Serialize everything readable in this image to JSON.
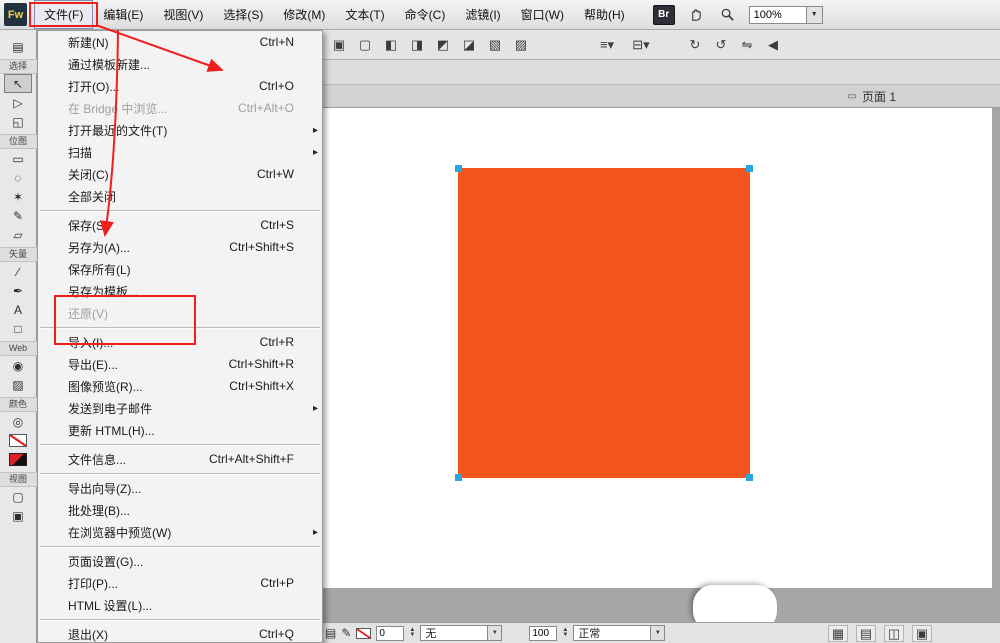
{
  "colors": {
    "annotation_red": "#f01f1f",
    "object_orange": "#f4551c",
    "handle_blue": "#2aa7e0",
    "canvas_gray": "#a6a6a6"
  },
  "icons": {
    "chevron_down": "▼",
    "dropdown_small": "▼",
    "spinner_up": "▲",
    "spinner_down": "▼",
    "page_glyph": "▭",
    "hand": "✋"
  },
  "app": {
    "icon_label": "Fw"
  },
  "menu_bar": {
    "items": [
      {
        "label": "文件(F)",
        "name": "menu-file",
        "class": "selected",
        "interactable": true
      },
      {
        "label": "编辑(E)",
        "name": "menu-edit",
        "interactable": true
      },
      {
        "label": "视图(V)",
        "name": "menu-view",
        "interactable": true
      },
      {
        "label": "选择(S)",
        "name": "menu-select",
        "interactable": true
      },
      {
        "label": "修改(M)",
        "name": "menu-modify",
        "interactable": true
      },
      {
        "label": "文本(T)",
        "name": "menu-text",
        "interactable": true
      },
      {
        "label": "命令(C)",
        "name": "menu-commands",
        "interactable": true
      },
      {
        "label": "滤镜(I)",
        "name": "menu-filters",
        "interactable": true
      },
      {
        "label": "窗口(W)",
        "name": "menu-window",
        "interactable": true
      },
      {
        "label": "帮助(H)",
        "name": "menu-help",
        "interactable": true
      }
    ],
    "bridge_label": "Br",
    "zoom_value": "100%"
  },
  "file_menu": {
    "items": [
      {
        "label": "新建(N)",
        "shortcut": "Ctrl+N",
        "arrow": "",
        "name": "file-menu-new",
        "interactable": true
      },
      {
        "label": "通过模板新建...",
        "shortcut": "",
        "arrow": "",
        "name": "file-menu-new-from-template",
        "interactable": true
      },
      {
        "label": "打开(O)...",
        "shortcut": "Ctrl+O",
        "arrow": "",
        "name": "file-menu-open",
        "interactable": true
      },
      {
        "label": "在 Bridge 中浏览...",
        "shortcut": "Ctrl+Alt+O",
        "arrow": "",
        "class": "disabled",
        "name": "file-menu-browse-bridge",
        "interactable": false
      },
      {
        "label": "打开最近的文件(T)",
        "shortcut": "",
        "arrow": "▸",
        "name": "file-menu-open-recent",
        "interactable": true
      },
      {
        "label": "扫描",
        "shortcut": "",
        "arrow": "▸",
        "name": "file-menu-scan",
        "interactable": true
      },
      {
        "label": "关闭(C)",
        "shortcut": "Ctrl+W",
        "arrow": "",
        "name": "file-menu-close",
        "interactable": true
      },
      {
        "label": "全部关闭",
        "shortcut": "",
        "arrow": "",
        "name": "file-menu-close-all",
        "interactable": true
      },
      {
        "class": "sep",
        "name": "menu-separator",
        "interactable": false
      },
      {
        "label": "保存(S)",
        "shortcut": "Ctrl+S",
        "arrow": "",
        "name": "file-menu-save",
        "interactable": true
      },
      {
        "label": "另存为(A)...",
        "shortcut": "Ctrl+Shift+S",
        "arrow": "",
        "name": "file-menu-save-as",
        "interactable": true
      },
      {
        "label": "保存所有(L)",
        "shortcut": "",
        "arrow": "",
        "name": "file-menu-save-all",
        "interactable": true
      },
      {
        "label": "另存为模板...",
        "shortcut": "",
        "arrow": "",
        "name": "file-menu-save-as-template",
        "interactable": true
      },
      {
        "label": "还原(V)",
        "shortcut": "",
        "arrow": "",
        "class": "disabled",
        "name": "file-menu-revert",
        "interactable": false
      },
      {
        "class": "sep",
        "name": "menu-separator",
        "interactable": false
      },
      {
        "label": "导入(I)...",
        "shortcut": "Ctrl+R",
        "arrow": "",
        "name": "file-menu-import",
        "interactable": true
      },
      {
        "label": "导出(E)...",
        "shortcut": "Ctrl+Shift+R",
        "arrow": "",
        "name": "file-menu-export",
        "interactable": true
      },
      {
        "label": "图像预览(R)...",
        "shortcut": "Ctrl+Shift+X",
        "arrow": "",
        "name": "file-menu-image-preview",
        "interactable": true
      },
      {
        "label": "发送到电子邮件",
        "shortcut": "",
        "arrow": "▸",
        "name": "file-menu-send-to-email",
        "interactable": true
      },
      {
        "label": "更新 HTML(H)...",
        "shortcut": "",
        "arrow": "",
        "name": "file-menu-update-html",
        "interactable": true
      },
      {
        "class": "sep",
        "name": "menu-separator",
        "interactable": false
      },
      {
        "label": "文件信息...",
        "shortcut": "Ctrl+Alt+Shift+F",
        "arrow": "",
        "name": "file-menu-file-info",
        "interactable": true
      },
      {
        "class": "sep",
        "name": "menu-separator",
        "interactable": false
      },
      {
        "label": "导出向导(Z)...",
        "shortcut": "",
        "arrow": "",
        "name": "file-menu-export-wizard",
        "interactable": true
      },
      {
        "label": "批处理(B)...",
        "shortcut": "",
        "arrow": "",
        "name": "file-menu-batch-process",
        "interactable": true
      },
      {
        "label": "在浏览器中预览(W)",
        "shortcut": "",
        "arrow": "▸",
        "name": "file-menu-preview-in-browser",
        "interactable": true
      },
      {
        "class": "sep",
        "name": "menu-separator",
        "interactable": false
      },
      {
        "label": "页面设置(G)...",
        "shortcut": "",
        "arrow": "",
        "name": "file-menu-page-setup",
        "interactable": true
      },
      {
        "label": "打印(P)...",
        "shortcut": "Ctrl+P",
        "arrow": "",
        "name": "file-menu-print",
        "interactable": true
      },
      {
        "label": "HTML 设置(L)...",
        "shortcut": "",
        "arrow": "",
        "name": "file-menu-html-setup",
        "interactable": true
      },
      {
        "class": "sep",
        "name": "menu-separator",
        "interactable": false
      },
      {
        "label": "退出(X)",
        "shortcut": "Ctrl+Q",
        "arrow": "",
        "name": "file-menu-exit",
        "interactable": true
      }
    ]
  },
  "toolbar": {
    "icons": [
      {
        "name": "group-icon",
        "glyph": "▣",
        "interactable": true
      },
      {
        "name": "ungroup-icon",
        "glyph": "▢",
        "interactable": true
      },
      {
        "name": "join-icon",
        "glyph": "◧",
        "interactable": true
      },
      {
        "name": "split-icon",
        "glyph": "◨",
        "interactable": true
      },
      {
        "name": "bring-to-front-icon",
        "glyph": "◩",
        "interactable": true
      },
      {
        "name": "bring-forward-icon",
        "glyph": "◪",
        "interactable": true
      },
      {
        "name": "send-backward-icon",
        "glyph": "▧",
        "interactable": true
      },
      {
        "name": "send-to-back-icon",
        "glyph": "▨",
        "interactable": true
      },
      {
        "name": "align-icon",
        "glyph": "≡▾",
        "class": "gap dd",
        "interactable": true
      },
      {
        "name": "distribute-icon",
        "glyph": "⊟▾",
        "class": "dd",
        "interactable": true
      },
      {
        "name": "rotate-cw-icon",
        "glyph": "↻",
        "class": "gap2",
        "interactable": true
      },
      {
        "name": "rotate-ccw-icon",
        "glyph": "↺",
        "interactable": true
      },
      {
        "name": "flip-horizontal-icon",
        "glyph": "⇋",
        "interactable": true
      },
      {
        "name": "flip-vertical-icon",
        "glyph": "◀",
        "interactable": true
      }
    ]
  },
  "toolpanel": {
    "rows": [
      {
        "class": "tool",
        "name": "new-document-icon",
        "glyph": "▤",
        "interactable": true
      },
      {
        "class": "label",
        "name": "tool-section-select",
        "label": "选择",
        "interactable": false
      },
      {
        "class": "tool selected",
        "name": "pointer-tool",
        "glyph": "↖",
        "interactable": true
      },
      {
        "class": "tool",
        "name": "select-behind-tool",
        "glyph": "▷",
        "interactable": true
      },
      {
        "class": "tool",
        "name": "scale-tool",
        "glyph": "◱",
        "interactable": true
      },
      {
        "class": "label",
        "name": "tool-section-bitmap",
        "label": "位图",
        "interactable": false
      },
      {
        "class": "tool",
        "name": "marquee-tool",
        "glyph": "▭",
        "interactable": true
      },
      {
        "class": "tool",
        "name": "lasso-tool",
        "glyph": "◌",
        "interactable": true
      },
      {
        "class": "tool",
        "name": "magic-wand-tool",
        "glyph": "✶",
        "interactable": true
      },
      {
        "class": "tool",
        "name": "brush-tool",
        "glyph": "✎",
        "interactable": true
      },
      {
        "class": "tool",
        "name": "eraser-tool",
        "glyph": "▱",
        "interactable": true
      },
      {
        "class": "label",
        "name": "tool-section-vector",
        "label": "矢量",
        "interactable": false
      },
      {
        "class": "tool",
        "name": "line-tool",
        "glyph": "∕",
        "interactable": true
      },
      {
        "class": "tool",
        "name": "pen-tool",
        "glyph": "✒",
        "interactable": true
      },
      {
        "class": "tool",
        "name": "text-tool",
        "glyph": "A",
        "interactable": true
      },
      {
        "class": "tool",
        "name": "rectangle-tool",
        "glyph": "□",
        "interactable": true
      },
      {
        "class": "label",
        "name": "tool-section-web",
        "label": "Web",
        "interactable": false
      },
      {
        "class": "tool",
        "name": "hotspot-tool",
        "glyph": "◉",
        "interactable": true
      },
      {
        "class": "tool",
        "name": "slice-tool",
        "glyph": "▨",
        "interactable": true
      },
      {
        "class": "label",
        "name": "tool-section-colors",
        "label": "颜色",
        "interactable": false
      },
      {
        "class": "tool",
        "name": "eyedropper-tool",
        "glyph": "◎",
        "interactable": true
      },
      {
        "class": "tool swatch-stroke",
        "name": "stroke-color-well",
        "glyph": "",
        "interactable": true
      },
      {
        "class": "tool swatch-fill",
        "name": "fill-color-well",
        "glyph": "",
        "interactable": true
      },
      {
        "class": "label",
        "name": "tool-section-view",
        "label": "视图",
        "interactable": false
      },
      {
        "class": "tool",
        "name": "standard-screen-mode-button",
        "glyph": "▢",
        "interactable": true
      },
      {
        "class": "tool",
        "name": "full-screen-mode-button",
        "glyph": "▣",
        "interactable": true
      }
    ]
  },
  "document": {
    "page_tab_label": "页面 1"
  },
  "props_bar": {
    "layer_icon_glyph": "▤",
    "pencil_glyph": "✎",
    "stroke_size": "0",
    "stroke_category": "无",
    "opacity": "100",
    "blend_mode": "正常",
    "buttons": [
      {
        "name": "grid-button",
        "glyph": "▦",
        "interactable": true
      },
      {
        "name": "rulers-button",
        "glyph": "▤",
        "interactable": true
      },
      {
        "name": "guides-button",
        "glyph": "◫",
        "interactable": true
      },
      {
        "name": "panels-button",
        "glyph": "▣",
        "interactable": true
      }
    ]
  }
}
